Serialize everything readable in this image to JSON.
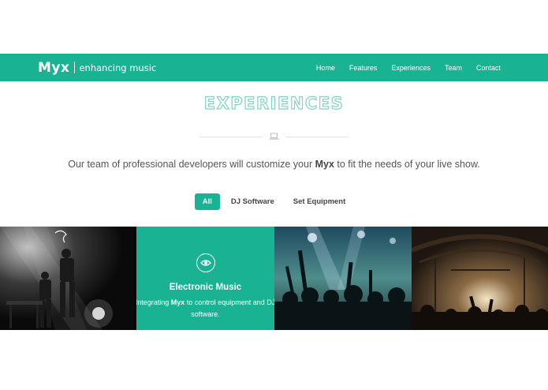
{
  "navbar": {
    "brand_name": "Myx",
    "brand_tagline": "enhancing music",
    "links": [
      "Home",
      "Features",
      "Experiences",
      "Team",
      "Contact"
    ]
  },
  "section": {
    "title": "EXPERIENCES",
    "subtitle_before": "Our team of professional developers will customize your ",
    "subtitle_brand": "Myx",
    "subtitle_after": " to fit the needs of your live show."
  },
  "filters": {
    "items": [
      "All",
      "DJ Software",
      "Set Equipment"
    ],
    "active": "All"
  },
  "gallery": {
    "featured": {
      "title": "Electronic Music",
      "desc_before": "Integrating ",
      "desc_brand": "Myx",
      "desc_after": " to control equipment and DJ software."
    }
  },
  "colors": {
    "accent": "#19b394",
    "title_outline": "#7fd4bf",
    "text": "#555555"
  },
  "icons": {
    "divider": "laptop-icon",
    "featured": "eye-icon"
  }
}
